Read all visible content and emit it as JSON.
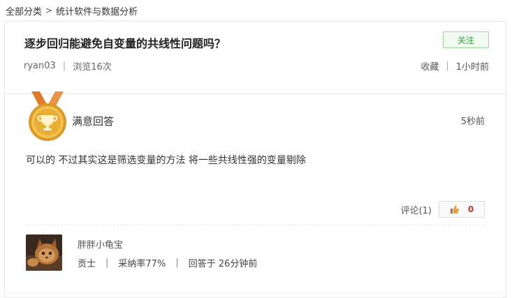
{
  "breadcrumb": {
    "root": "全部分类",
    "separator": ">",
    "current": "统计软件与数据分析"
  },
  "question": {
    "title": "逐步回归能避免自变量的共线性问题吗？",
    "follow_label": "关注",
    "author": "ryan03",
    "views": "浏览16次",
    "collect_label": "收藏",
    "time": "1小时前"
  },
  "answer": {
    "badge_label": "满意回答",
    "time": "5秒前",
    "text": "可以的 不过其实这是筛选变量的方法 将一些共线性强的变量剔除",
    "comment_label": "评论(1)",
    "like_count": "0",
    "medal_icon": "gold-medal-icon",
    "like_icon": "thumbs-up-icon"
  },
  "answerer": {
    "name": "胖胖小龟宝",
    "rank": "贡士",
    "adoption_rate": "采纳率77%",
    "answered": "回答于 26分钟前"
  },
  "colors": {
    "follow_border": "#9fd39f",
    "follow_text": "#3c9a3c",
    "like_count": "#c0392b",
    "medal_gold": "#e8a93a",
    "medal_ribbon": "#e07a2a"
  }
}
